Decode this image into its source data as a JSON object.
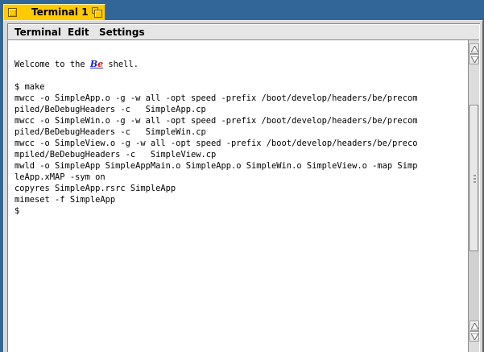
{
  "window": {
    "title": "Terminal 1",
    "accent_tab_color": "#ffcb00",
    "desktop_color": "#336698"
  },
  "menubar": {
    "items": [
      "Terminal",
      "Edit",
      "Settings"
    ]
  },
  "terminal": {
    "welcome_prefix": "Welcome to the ",
    "welcome_logo": "Be",
    "welcome_suffix": " shell.",
    "lines": [
      "$ make",
      "mwcc -o SimpleApp.o -g -w all -opt speed -prefix /boot/develop/headers/be/precom",
      "piled/BeDebugHeaders -c   SimpleApp.cp",
      "mwcc -o SimpleWin.o -g -w all -opt speed -prefix /boot/develop/headers/be/precom",
      "piled/BeDebugHeaders -c   SimpleWin.cp",
      "mwcc -o SimpleView.o -g -w all -opt speed -prefix /boot/develop/headers/be/preco",
      "mpiled/BeDebugHeaders -c   SimpleView.cp",
      "mwld -o SimpleApp SimpleAppMain.o SimpleApp.o SimpleWin.o SimpleView.o -map Simp",
      "leApp.xMAP -sym on",
      "copyres SimpleApp.rsrc SimpleApp",
      "mimeset -f SimpleApp",
      "$"
    ]
  },
  "scrollbar": {
    "up_icon": "arrow-up-icon",
    "down_icon": "arrow-down-icon",
    "position_fraction": 0.0,
    "visible_fraction": 0.68
  }
}
